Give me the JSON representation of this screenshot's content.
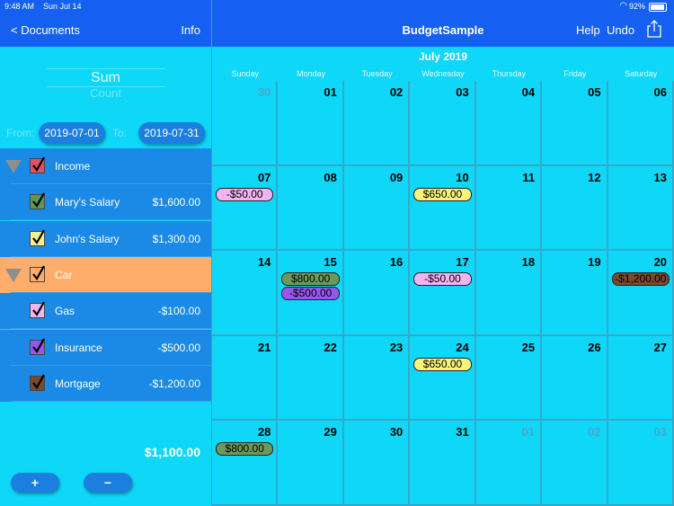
{
  "status": {
    "time": "9:48 AM",
    "date": "Sun Jul 14",
    "battery": "92%"
  },
  "nav_left": {
    "back": "< Documents",
    "info": "Info"
  },
  "nav_right": {
    "title": "BudgetSample",
    "help": "Help",
    "undo": "Undo"
  },
  "summary": {
    "sum": "Sum",
    "count": "Count",
    "from_label": "From:",
    "to_label": "To:",
    "from": "2019-07-01",
    "to": "2019-07-31",
    "total": "$1,100.00"
  },
  "categories": [
    {
      "name": "Income",
      "amount": "",
      "kind": "group",
      "bg": "#1a8ae6",
      "check_color": "#e05060",
      "expanded": true
    },
    {
      "name": "Mary's Salary",
      "amount": "$1,600.00",
      "kind": "item",
      "bg": "#1a8ae6",
      "check_color": "#5a9a50"
    },
    {
      "name": "John's Salary",
      "amount": "$1,300.00",
      "kind": "item",
      "bg": "#1a8ae6",
      "check_color": "#f4f28a"
    },
    {
      "name": "Car",
      "amount": "",
      "kind": "group",
      "bg": "#ffad6a",
      "check_color": "#ffad6a",
      "expanded": true
    },
    {
      "name": "Gas",
      "amount": "-$100.00",
      "kind": "item",
      "bg": "#1a8ae6",
      "check_color": "#f2b4f0"
    },
    {
      "name": "Insurance",
      "amount": "-$500.00",
      "kind": "item",
      "bg": "#1a8ae6",
      "check_color": "#9955f0"
    },
    {
      "name": "Mortgage",
      "amount": "-$1,200.00",
      "kind": "item",
      "bg": "#1a8ae6",
      "check_color": "#7a4a2a"
    }
  ],
  "buttons": {
    "add": "+",
    "remove": "−"
  },
  "calendar": {
    "month": "July 2019",
    "weekdays": [
      "Sunday",
      "Monday",
      "Tuesday",
      "Wednesday",
      "Thursday",
      "Friday",
      "Saturday"
    ],
    "weeks": [
      [
        {
          "day": "30",
          "dim": true
        },
        {
          "day": "01"
        },
        {
          "day": "02"
        },
        {
          "day": "03"
        },
        {
          "day": "04"
        },
        {
          "day": "05"
        },
        {
          "day": "06"
        }
      ],
      [
        {
          "day": "07",
          "events": [
            {
              "label": "-$50.00",
              "color": "#f2b4f0"
            }
          ]
        },
        {
          "day": "08"
        },
        {
          "day": "09"
        },
        {
          "day": "10",
          "events": [
            {
              "label": "$650.00",
              "color": "#f8f47a"
            }
          ]
        },
        {
          "day": "11"
        },
        {
          "day": "12"
        },
        {
          "day": "13"
        }
      ],
      [
        {
          "day": "14"
        },
        {
          "day": "15",
          "events": [
            {
              "label": "$800.00",
              "color": "#6a9a5a"
            },
            {
              "label": "-$500.00",
              "color": "#9955f0"
            }
          ]
        },
        {
          "day": "16"
        },
        {
          "day": "17",
          "events": [
            {
              "label": "-$50.00",
              "color": "#f2b4f0"
            }
          ]
        },
        {
          "day": "18"
        },
        {
          "day": "19"
        },
        {
          "day": "20",
          "events": [
            {
              "label": "-$1,200.00",
              "color": "#7a4a2a"
            }
          ]
        }
      ],
      [
        {
          "day": "21"
        },
        {
          "day": "22"
        },
        {
          "day": "23"
        },
        {
          "day": "24",
          "events": [
            {
              "label": "$650.00",
              "color": "#f8f47a"
            }
          ]
        },
        {
          "day": "25"
        },
        {
          "day": "26"
        },
        {
          "day": "27"
        }
      ],
      [
        {
          "day": "28",
          "events": [
            {
              "label": "$800.00",
              "color": "#6a9a5a"
            }
          ]
        },
        {
          "day": "29"
        },
        {
          "day": "30"
        },
        {
          "day": "31"
        },
        {
          "day": "01",
          "dim": true
        },
        {
          "day": "02",
          "dim": true
        },
        {
          "day": "03",
          "dim": true
        }
      ]
    ]
  }
}
